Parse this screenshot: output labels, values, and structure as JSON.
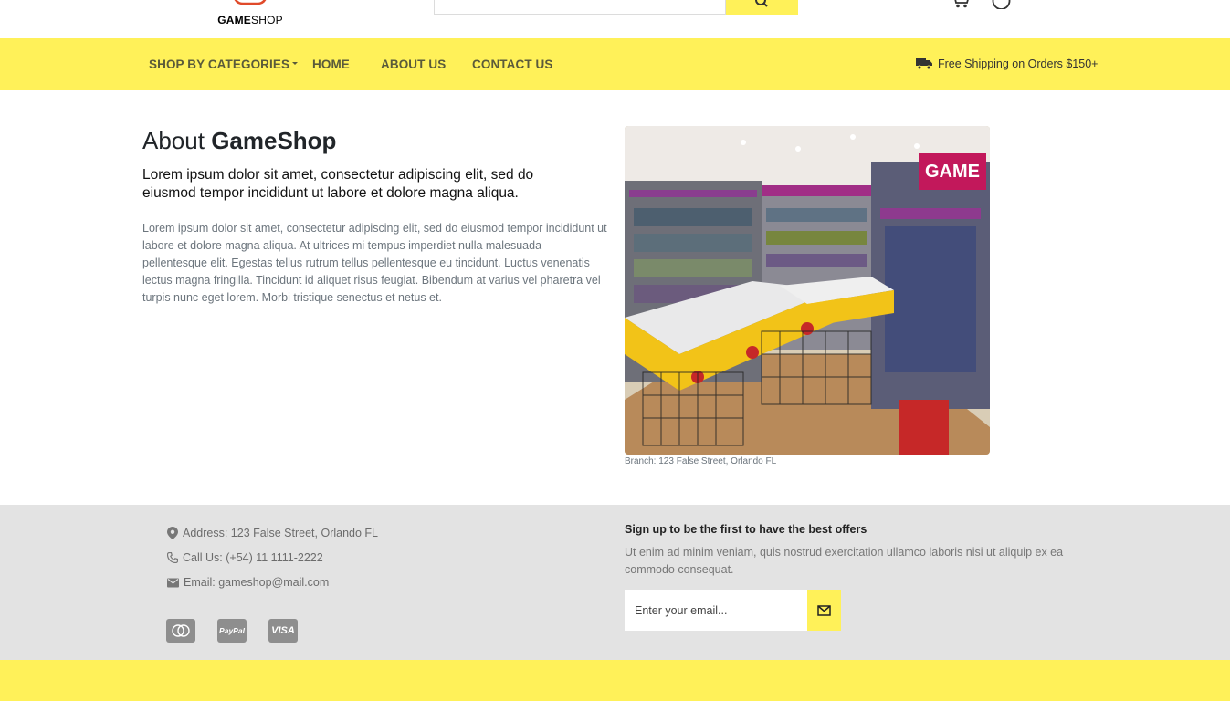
{
  "brand": {
    "logo_prefix": "GAME",
    "logo_suffix": "SHOP"
  },
  "search": {
    "placeholder": ""
  },
  "header_icons": [
    "cart-icon",
    "user-icon"
  ],
  "nav": {
    "categories_label": "SHOP BY CATEGORIES",
    "home_label": "HOME",
    "about_label": "ABOUT US",
    "contact_label": "CONTACT US",
    "shipping_text": "Free Shipping on Orders $150+"
  },
  "about": {
    "title_prefix": "About",
    "title_brand": "GameShop",
    "lead": "Lorem ipsum dolor sit amet, consectetur adipiscing elit, sed do eiusmod tempor incididunt ut labore et dolore magna aliqua.",
    "body": "Lorem ipsum dolor sit amet, consectetur adipiscing elit, sed do eiusmod tempor incididunt ut labore et dolore magna aliqua. At ultrices mi tempus imperdiet nulla malesuada pellentesque elit. Egestas tellus rutrum tellus pellentesque eu tincidunt. Luctus venenatis lectus magna fringilla. Tincidunt id aliquet risus feugiat. Bibendum at varius vel pharetra vel turpis nunc eget lorem. Morbi tristique senectus et netus et.",
    "image_caption": "Branch: 123 False Street, Orlando FL",
    "store_sign": "GAME"
  },
  "footer": {
    "address": "Address: 123 False Street, Orlando FL",
    "phone": "Call Us: (+54) 11 1111-2222",
    "email": "Email: gameshop@mail.com",
    "payments": [
      {
        "name": "mastercard",
        "label": ""
      },
      {
        "name": "paypal",
        "label": "PayPal"
      },
      {
        "name": "visa",
        "label": "VISA"
      }
    ],
    "newsletter_title": "Sign up to be the first to have the best offers",
    "newsletter_text": "Ut enim ad minim veniam, quis nostrud exercitation ullamco laboris nisi ut aliquip ex ea commodo consequat.",
    "email_placeholder": "Enter your email..."
  },
  "colors": {
    "accent": "#fff159",
    "footer_bg": "#e3e3e3"
  }
}
